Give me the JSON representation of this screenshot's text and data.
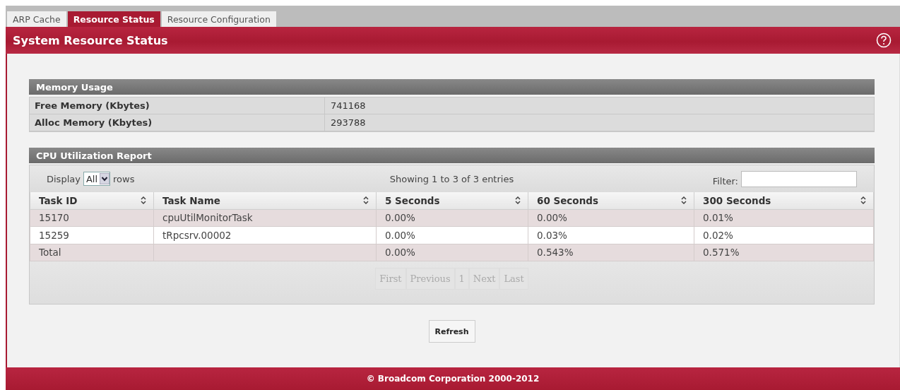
{
  "tabs": [
    {
      "label": "ARP Cache",
      "selected": false
    },
    {
      "label": "Resource Status",
      "selected": true
    },
    {
      "label": "Resource Configuration",
      "selected": false
    }
  ],
  "header": {
    "title": "System Resource Status"
  },
  "memory": {
    "title": "Memory Usage",
    "rows": [
      {
        "label": "Free Memory  (Kbytes)",
        "value": "741168"
      },
      {
        "label": "Alloc Memory  (Kbytes)",
        "value": "293788"
      }
    ]
  },
  "cpu": {
    "title": "CPU Utilization Report",
    "display_label": "Display",
    "display_value": "All",
    "rows_label": "rows",
    "info": "Showing 1 to 3 of 3 entries",
    "filter_label": "Filter:",
    "columns": [
      "Task ID",
      "Task Name",
      "5 Seconds",
      "60 Seconds",
      "300 Seconds"
    ],
    "rows": [
      [
        "15170",
        "cpuUtilMonitorTask",
        "0.00%",
        "0.00%",
        "0.01%"
      ],
      [
        "15259",
        "tRpcsrv.00002",
        "0.00%",
        "0.03%",
        "0.02%"
      ],
      [
        "Total",
        "",
        "0.00%",
        "0.543%",
        "0.571%"
      ]
    ],
    "pager": [
      {
        "label": "First",
        "disabled": true
      },
      {
        "label": "Previous",
        "disabled": true
      },
      {
        "label": "1",
        "disabled": true
      },
      {
        "label": "Next",
        "disabled": true
      },
      {
        "label": "Last",
        "disabled": true
      }
    ]
  },
  "buttons": [
    "Refresh"
  ],
  "footer": "© Broadcom Corporation 2000-2012"
}
